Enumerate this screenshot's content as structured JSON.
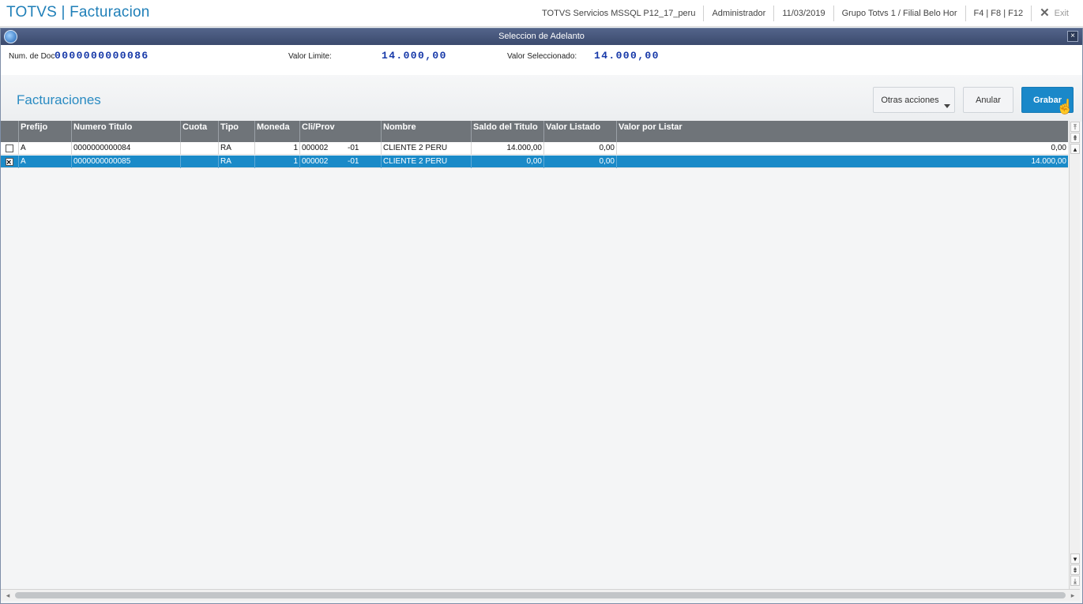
{
  "app": {
    "title": "TOTVS | Facturacion",
    "environment": "TOTVS Servicios MSSQL P12_17_peru",
    "user": "Administrador",
    "date": "11/03/2019",
    "branch": "Grupo Totvs 1 / Filial Belo Hor",
    "shortcuts": "F4 | F8 | F12",
    "exit_label": "Exit"
  },
  "dialog": {
    "title": "Seleccion de Adelanto",
    "close_label": "×",
    "doc_label": "Num. de Doc",
    "doc_value": "0000000000086",
    "limit_label": "Valor Limite:",
    "limit_value": "14.000,00",
    "selected_label": "Valor Seleccionado:",
    "selected_value": "14.000,00"
  },
  "toolbar": {
    "section_title": "Facturaciones",
    "more_label": "Otras acciones",
    "cancel_label": "Anular",
    "save_label": "Grabar"
  },
  "grid": {
    "columns": [
      "Prefijo",
      "Numero Titulo",
      "Cuota",
      "Tipo",
      "Moneda",
      "Cli/Prov",
      "Nombre",
      "Saldo del Titulo",
      "Valor Listado",
      "Valor por Listar"
    ],
    "rows": [
      {
        "checked": false,
        "prefijo": "A",
        "numero": "0000000000084",
        "cuota": "",
        "tipo": "RA",
        "moneda": "1",
        "cliprov": "000002",
        "loja": "-01",
        "nombre": "CLIENTE 2 PERU",
        "saldo": "14.000,00",
        "listado": "0,00",
        "por_listar": "0,00"
      },
      {
        "checked": true,
        "prefijo": "A",
        "numero": "0000000000085",
        "cuota": "",
        "tipo": "RA",
        "moneda": "1",
        "cliprov": "000002",
        "loja": "-01",
        "nombre": "CLIENTE 2 PERU",
        "saldo": "0,00",
        "listado": "0,00",
        "por_listar": "14.000,00"
      }
    ]
  },
  "icons": {
    "logo": "totvs-logo-icon",
    "close": "close-icon",
    "exit": "close-icon",
    "scroll_top": "scroll-top-icon",
    "page_up": "page-up-icon",
    "line_up": "arrow-up-icon",
    "line_down": "arrow-down-icon",
    "page_down": "page-down-icon",
    "scroll_bottom": "scroll-bottom-icon"
  }
}
